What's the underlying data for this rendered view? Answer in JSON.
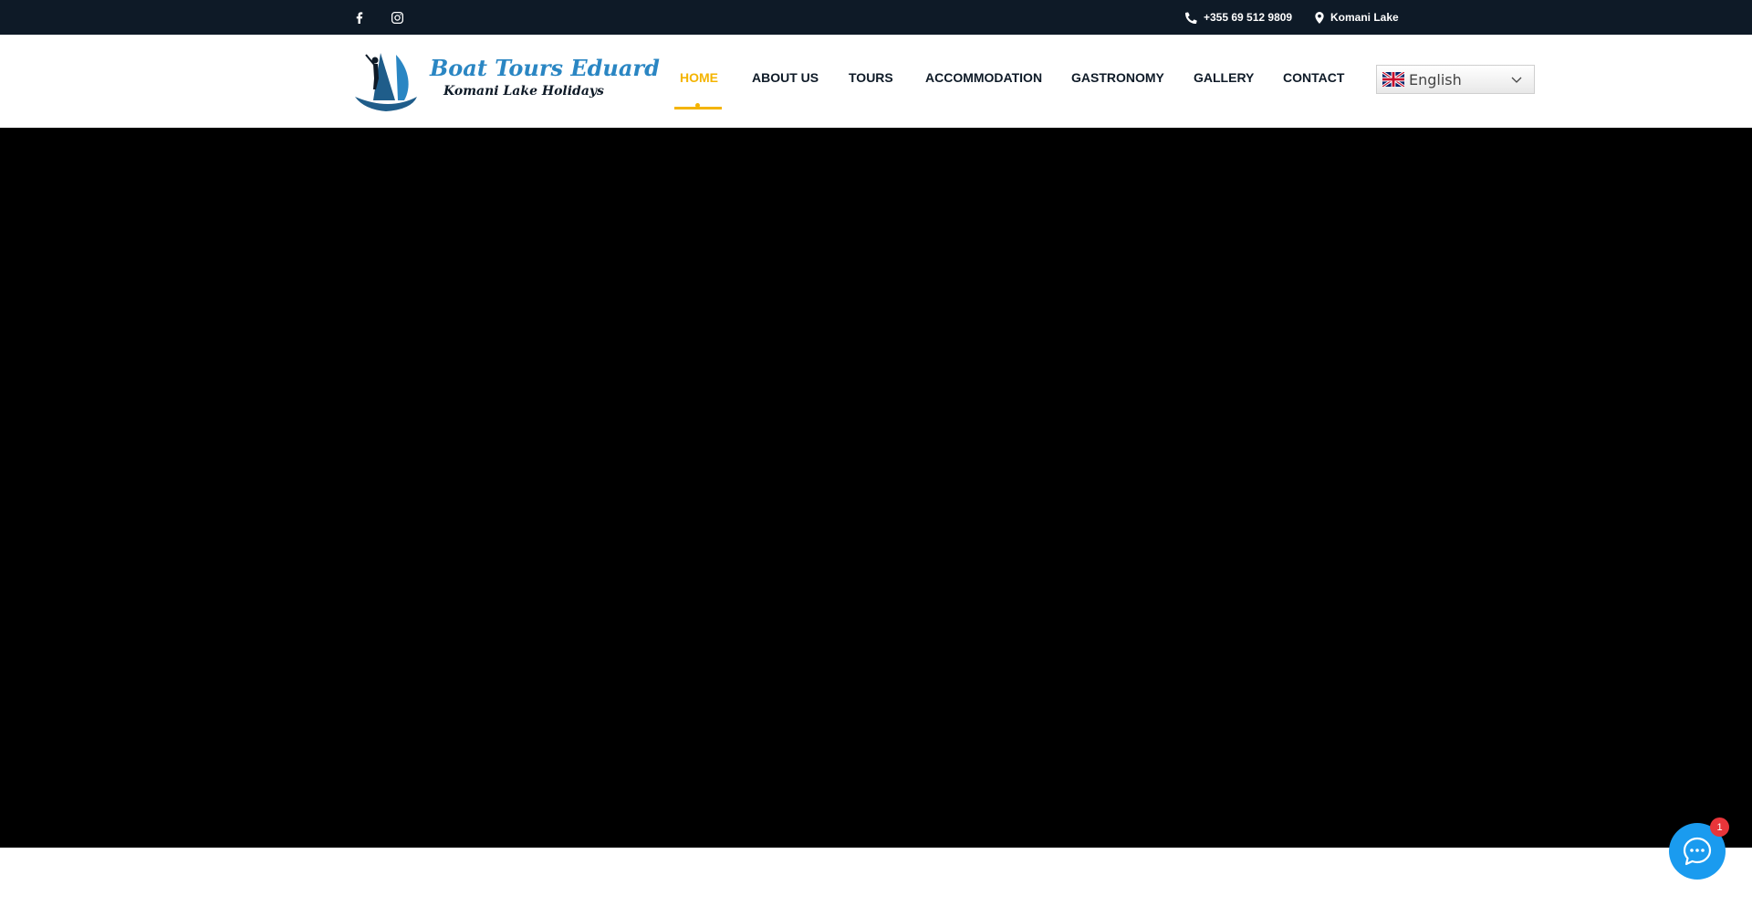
{
  "topbar": {
    "social": [
      {
        "icon": "facebook-icon"
      },
      {
        "icon": "instagram-icon"
      }
    ],
    "phone": "+355 69 512 9809",
    "location": "Komani Lake"
  },
  "header": {
    "logo": {
      "title": "Boat Tours Eduard",
      "subtitle": "Komani Lake Holidays"
    },
    "nav": [
      {
        "label": "HOME",
        "active": true
      },
      {
        "label": "ABOUT US"
      },
      {
        "label": "TOURS"
      },
      {
        "label": "ACCOMMODATION"
      },
      {
        "label": "GASTRONOMY"
      },
      {
        "label": "GALLERY"
      },
      {
        "label": "CONTACT"
      }
    ],
    "language": {
      "label": "English",
      "icon": "uk-flag-icon"
    }
  },
  "chat": {
    "badge": "1",
    "icon": "chat-bubble-icon"
  },
  "colors": {
    "accent": "#f4b400",
    "topbar": "#0e1a27",
    "chat": "#1a9bef",
    "badge": "#e8353a",
    "hero": "#000000"
  }
}
